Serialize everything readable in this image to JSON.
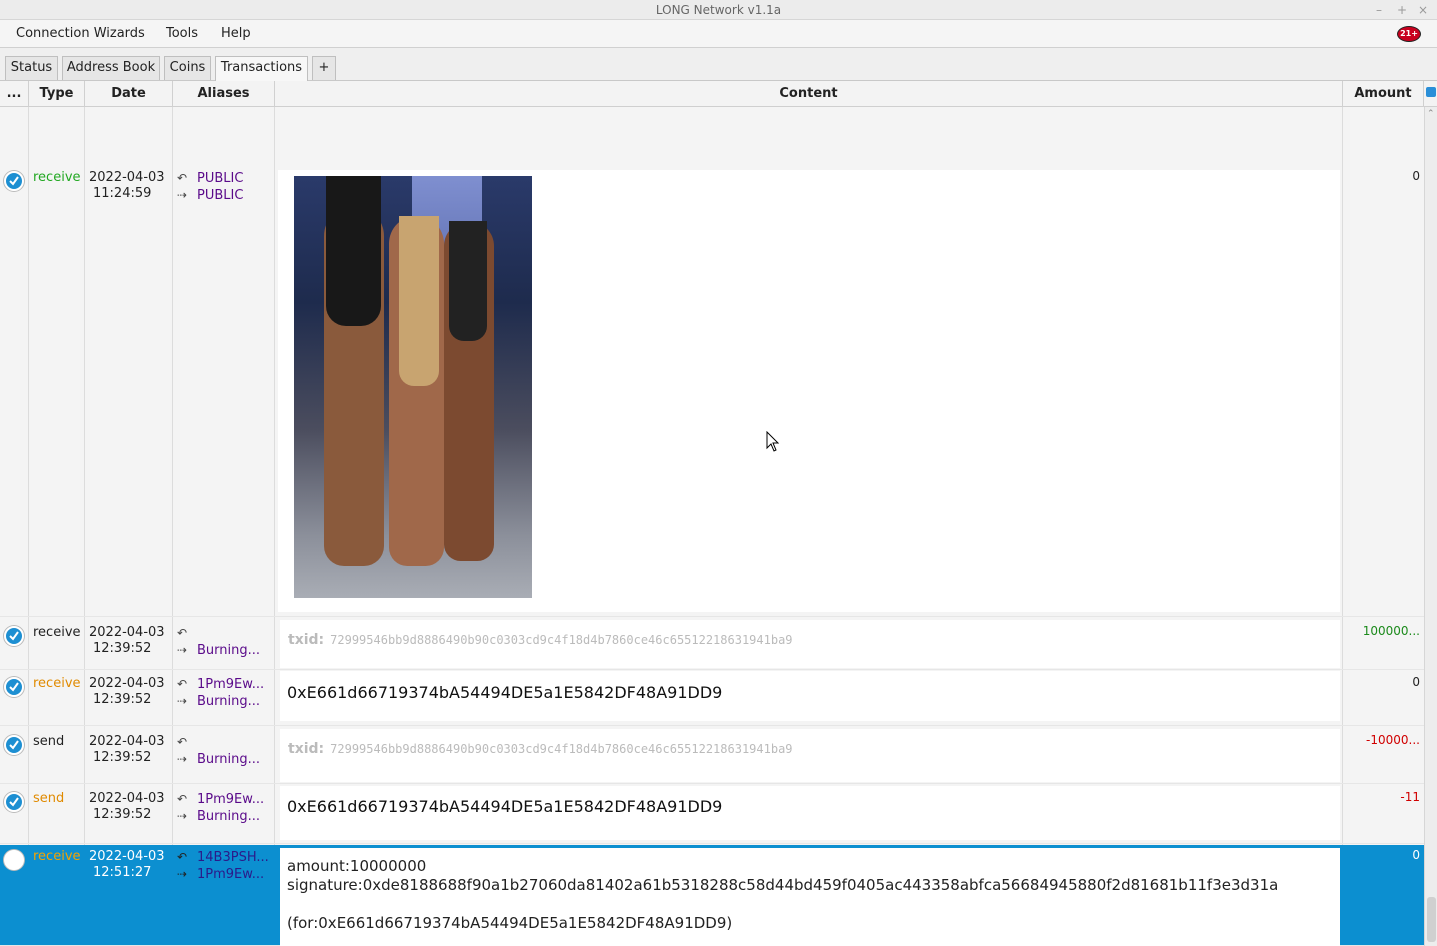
{
  "window": {
    "title": "LONG Network v1.1a",
    "controls": [
      "–",
      "+",
      "×"
    ]
  },
  "menu": {
    "items": [
      "Connection Wizards",
      "Tools",
      "Help"
    ],
    "badge": "21+"
  },
  "tabs": [
    "Status",
    "Address Book",
    "Coins",
    "Transactions",
    "+"
  ],
  "active_tab": "Transactions",
  "columns": [
    "...",
    "Type",
    "Date",
    "Aliases",
    "Content",
    "Amount"
  ],
  "rows": [
    {
      "type": "receive",
      "date": "2022-04-03",
      "time": "11:24:59",
      "alias1": "PUBLIC",
      "alias2": "PUBLIC",
      "content": "",
      "amount": "0"
    },
    {
      "type": "receive",
      "date": "2022-04-03",
      "time": "12:39:52",
      "alias1": "",
      "alias2": "Burning...",
      "content_label": "txid:",
      "content": "72999546bb9d8886490b90c0303cd9c4f18d4b7860ce46c65512218631941ba9",
      "amount": "100000..."
    },
    {
      "type": "receive",
      "date": "2022-04-03",
      "time": "12:39:52",
      "alias1": "1Pm9Ew...",
      "alias2": "Burning...",
      "content": "0xE661d66719374bA54494DE5a1E5842DF48A91DD9",
      "amount": "0"
    },
    {
      "type": "send",
      "date": "2022-04-03",
      "time": "12:39:52",
      "alias1": "",
      "alias2": "Burning...",
      "content_label": "txid:",
      "content": "72999546bb9d8886490b90c0303cd9c4f18d4b7860ce46c65512218631941ba9",
      "amount": "-10000..."
    },
    {
      "type": "send",
      "date": "2022-04-03",
      "time": "12:39:52",
      "alias1": "1Pm9Ew...",
      "alias2": "Burning...",
      "content": "0xE661d66719374bA54494DE5a1E5842DF48A91DD9",
      "amount": "-11"
    },
    {
      "type": "receive",
      "date": "2022-04-03",
      "time": "12:51:27",
      "alias1": "14B3PSH...",
      "alias2": "1Pm9Ew...",
      "content_line1": "amount:10000000",
      "content_line2": "signature:0xde8188688f90a1b27060da81402a61b5318288c58d44bd459f0405ac443358abfca56684945880f2d81681b11f3e3d31a",
      "content_line3": "(for:0xE661d66719374bA54494DE5a1E5842DF48A91DD9)",
      "amount": "0"
    }
  ],
  "colors": {
    "receive_highlight": "#22a822",
    "send_orange": "#e08a00",
    "alias_purple": "#5a0a8a",
    "selected": "#0c8fd0",
    "positive_amount": "#1b8a1b",
    "negative_amount": "#d00000"
  }
}
